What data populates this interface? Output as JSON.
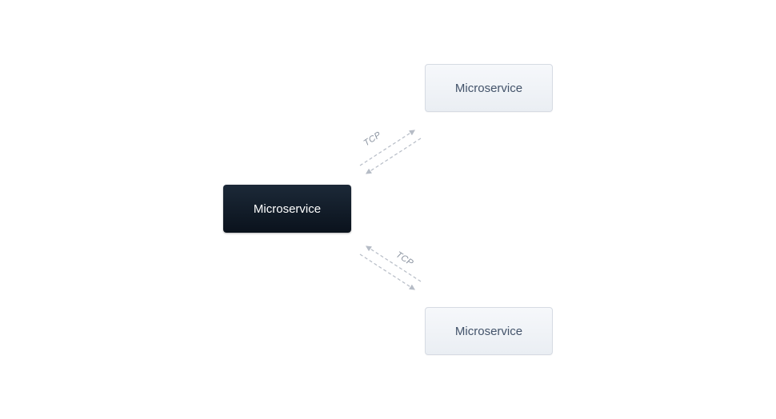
{
  "nodes": {
    "primary": {
      "label": "Microservice"
    },
    "topRight": {
      "label": "Microservice"
    },
    "bottomRight": {
      "label": "Microservice"
    }
  },
  "connections": {
    "top": {
      "label": "TCP"
    },
    "bottom": {
      "label": "TCP"
    }
  },
  "colors": {
    "darkNodeBg": "#0f1a26",
    "lightNodeBg": "#eef2f7",
    "lightNodeText": "#4a5a72",
    "connectorStroke": "#b6bcc6",
    "labelColor": "#8a93a0"
  }
}
